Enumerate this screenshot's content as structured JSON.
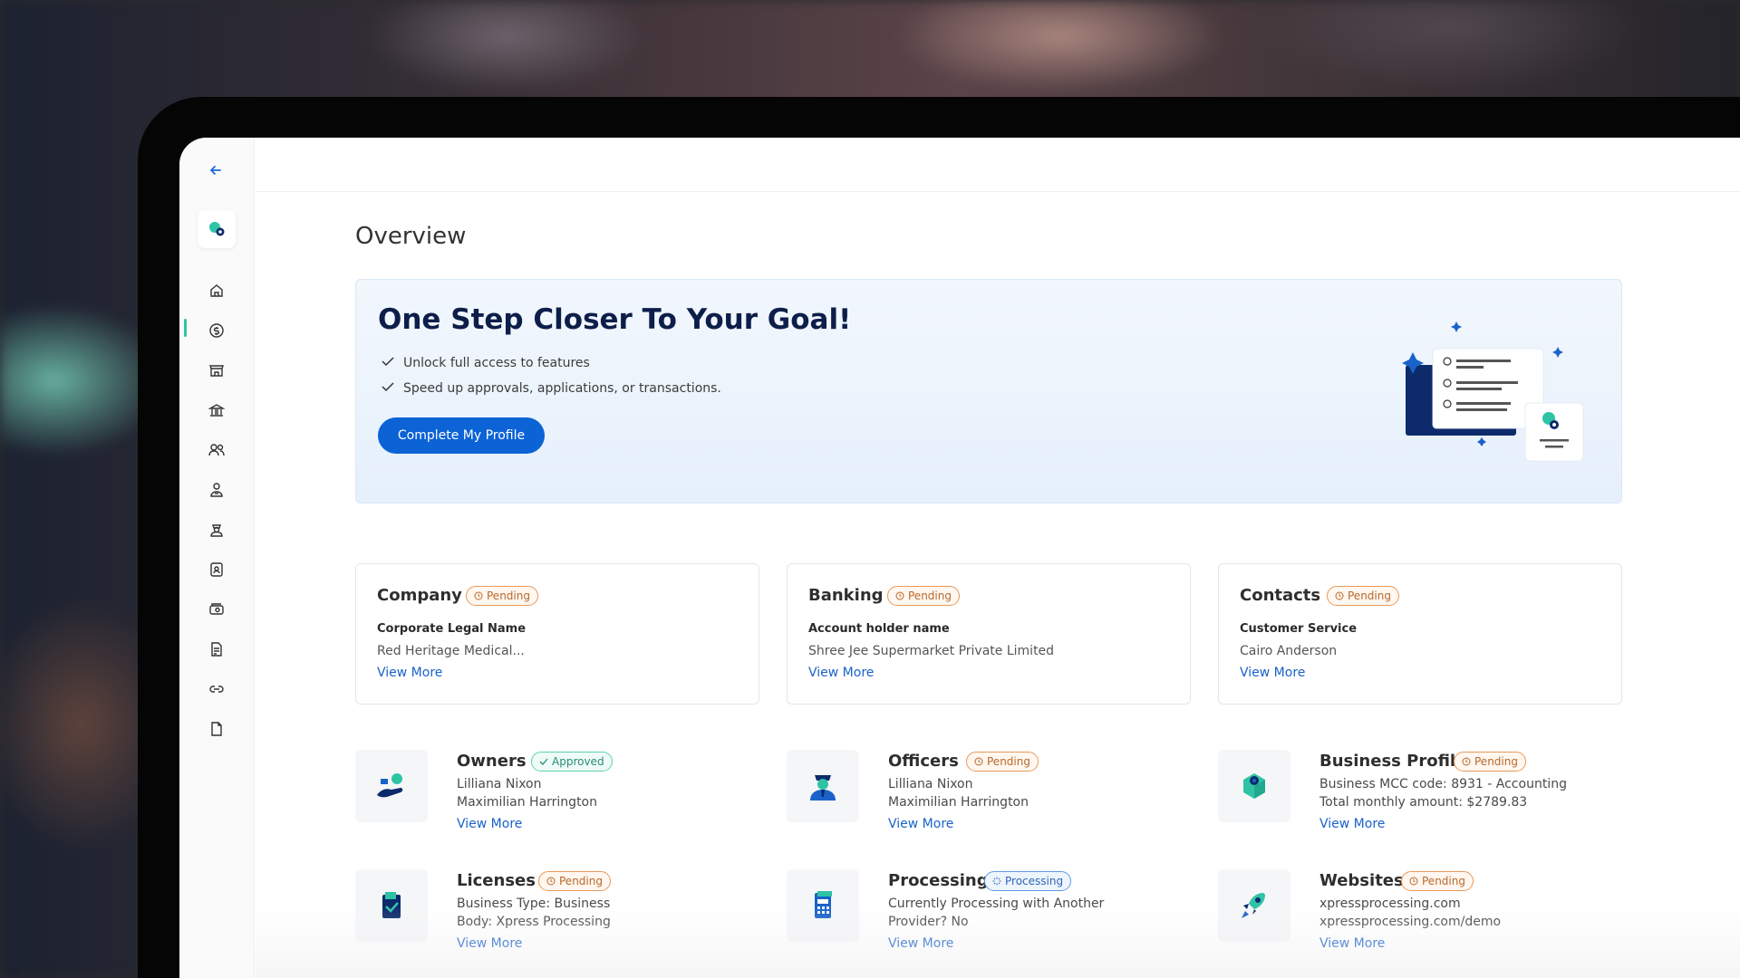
{
  "page": {
    "title": "Overview"
  },
  "sidebar": {
    "items": [
      {
        "icon": "home-icon"
      },
      {
        "icon": "dollar-icon",
        "active": true
      },
      {
        "icon": "store-icon"
      },
      {
        "icon": "bank-icon"
      },
      {
        "icon": "users-icon"
      },
      {
        "icon": "owner-icon"
      },
      {
        "icon": "officer-icon"
      },
      {
        "icon": "id-card-icon"
      },
      {
        "icon": "processing-icon"
      },
      {
        "icon": "license-icon"
      },
      {
        "icon": "link-icon"
      },
      {
        "icon": "document-icon"
      }
    ]
  },
  "banner": {
    "title": "One Step Closer To Your Goal!",
    "checks": [
      "Unlock full access to features",
      "Speed up approvals, applications, or transactions."
    ],
    "cta": "Complete My Profile"
  },
  "cards": [
    {
      "title": "Company",
      "badge": "Pending",
      "label": "Corporate Legal Name",
      "value": "Red Heritage Medical...",
      "link": "View More"
    },
    {
      "title": "Banking",
      "badge": "Pending",
      "label": "Account holder name",
      "value": "Shree Jee Supermarket Private Limited",
      "link": "View More"
    },
    {
      "title": "Contacts",
      "badge": "Pending",
      "label": "Customer Service",
      "value": "Cairo Anderson",
      "link": "View More"
    }
  ],
  "sections": [
    {
      "title": "Owners",
      "badge": "Approved",
      "lines": [
        "Lilliana Nixon",
        "Maximilian Harrington"
      ],
      "link": "View More"
    },
    {
      "title": "Officers",
      "badge": "Pending",
      "lines": [
        "Lilliana Nixon",
        "Maximilian Harrington"
      ],
      "link": "View More"
    },
    {
      "title": "Business Profile",
      "badge": "Pending",
      "lines": [
        "Business MCC code: 8931 - Accounting",
        "Total monthly amount: $2789.83"
      ],
      "link": "View More"
    },
    {
      "title": "Licenses",
      "badge": "Pending",
      "lines": [
        "Business Type:  Business",
        "Body: Xpress Processing"
      ],
      "link": "View More"
    },
    {
      "title": "Processing",
      "badge": "Processing",
      "lines": [
        "Currently Processing with Another",
        "Provider?  No"
      ],
      "link": "View More"
    },
    {
      "title": "Websites",
      "badge": "Pending",
      "lines": [
        "xpressprocessing.com",
        "xpressprocessing.com/demo"
      ],
      "link": "View More"
    }
  ],
  "colors": {
    "primary": "#0b63d6",
    "accent": "#2fc3a6",
    "pending": "#e89a5a",
    "approved": "#5fd1b5",
    "processing": "#5f9be6"
  }
}
